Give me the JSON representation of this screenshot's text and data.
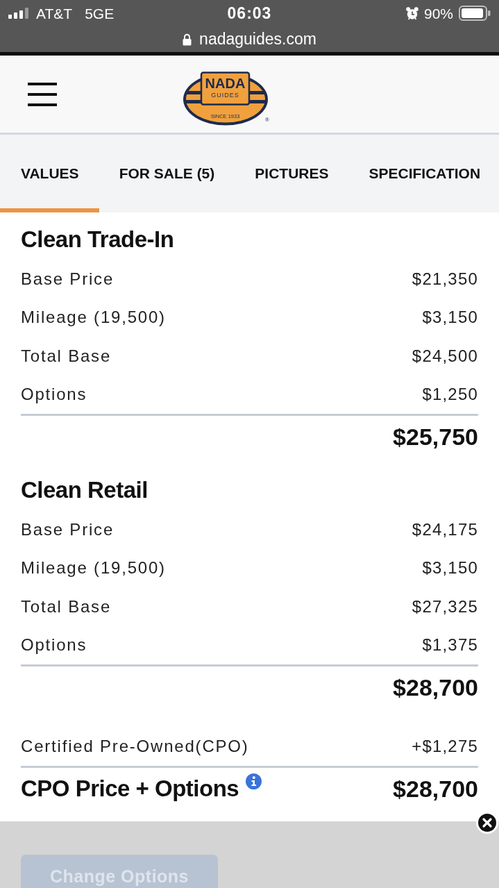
{
  "status_bar": {
    "carrier": "AT&T",
    "network": "5GE",
    "time": "06:03",
    "battery": "90%"
  },
  "address_bar": {
    "url": "nadaguides.com"
  },
  "header": {
    "logo": {
      "name": "NADA",
      "subtitle": "GUIDES",
      "since": "SINCE 1933",
      "registered": "®"
    }
  },
  "tabs": [
    {
      "label": "VALUES",
      "selected": true
    },
    {
      "label": "FOR SALE (5)",
      "selected": false
    },
    {
      "label": "PICTURES",
      "selected": false
    },
    {
      "label": "SPECIFICATION",
      "selected": false
    }
  ],
  "sections": [
    {
      "title": "Clean Trade-In",
      "rows": [
        {
          "label": "Base Price",
          "value": "$21,350"
        },
        {
          "label": "Mileage (19,500)",
          "value": "$3,150"
        },
        {
          "label": "Total Base",
          "value": "$24,500"
        },
        {
          "label": "Options",
          "value": "$1,250"
        }
      ],
      "total": "$25,750"
    },
    {
      "title": "Clean Retail",
      "rows": [
        {
          "label": "Base Price",
          "value": "$24,175"
        },
        {
          "label": "Mileage (19,500)",
          "value": "$3,150"
        },
        {
          "label": "Total Base",
          "value": "$27,325"
        },
        {
          "label": "Options",
          "value": "$1,375"
        }
      ],
      "total": "$28,700"
    }
  ],
  "cpo": {
    "label": "Certified Pre-Owned(CPO)",
    "value": "+$1,275"
  },
  "cpo_total": {
    "label": "CPO Price + Options",
    "value": "$28,700"
  },
  "footer": {
    "button": {
      "label": "Change Options",
      "disabled": true
    }
  }
}
